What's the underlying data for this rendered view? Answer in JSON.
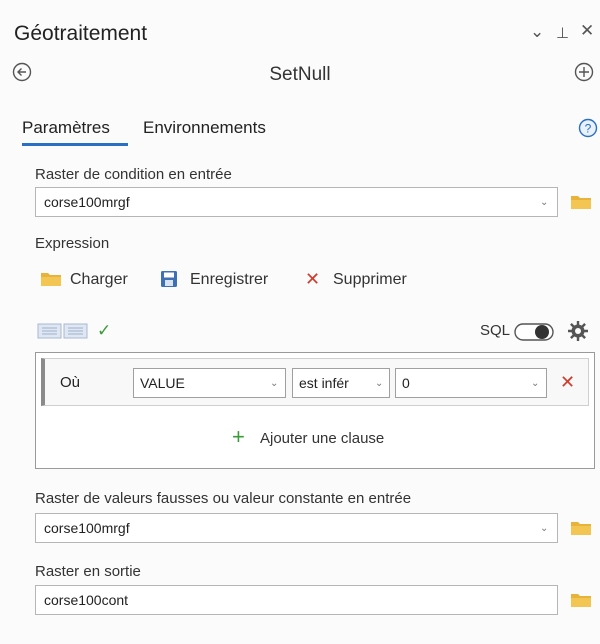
{
  "panel": {
    "title": "Géotraitement"
  },
  "tool": {
    "title": "SetNull"
  },
  "tabs": [
    {
      "label": "Paramètres"
    },
    {
      "label": "Environnements"
    }
  ],
  "params": {
    "cond_label": "Raster de condition en entrée",
    "cond_value": "corse100mrgf",
    "expr_label": "Expression",
    "false_label": "Raster de valeurs fausses ou valeur constante en entrée",
    "false_value": "corse100mrgf",
    "out_label": "Raster en sortie",
    "out_value": "corse100cont"
  },
  "expr_actions": {
    "load": "Charger",
    "save": "Enregistrer",
    "delete": "Supprimer"
  },
  "sql": {
    "label": "SQL"
  },
  "clause": {
    "where": "Où",
    "field": "VALUE",
    "operator": "est infér",
    "value": "0"
  },
  "add_clause": "Ajouter une clause",
  "colors": {
    "accent": "#2a6fc4",
    "folder": "#e8b33a",
    "delete": "#d23b2b",
    "check": "#3a9b3a"
  },
  "icons": [
    "chevron-down-icon",
    "pin-icon",
    "close-icon",
    "back-icon",
    "add-icon",
    "help-icon",
    "folder-icon",
    "save-icon",
    "delete-icon",
    "check-icon",
    "gear-icon",
    "toggle-icon",
    "plus-icon"
  ]
}
